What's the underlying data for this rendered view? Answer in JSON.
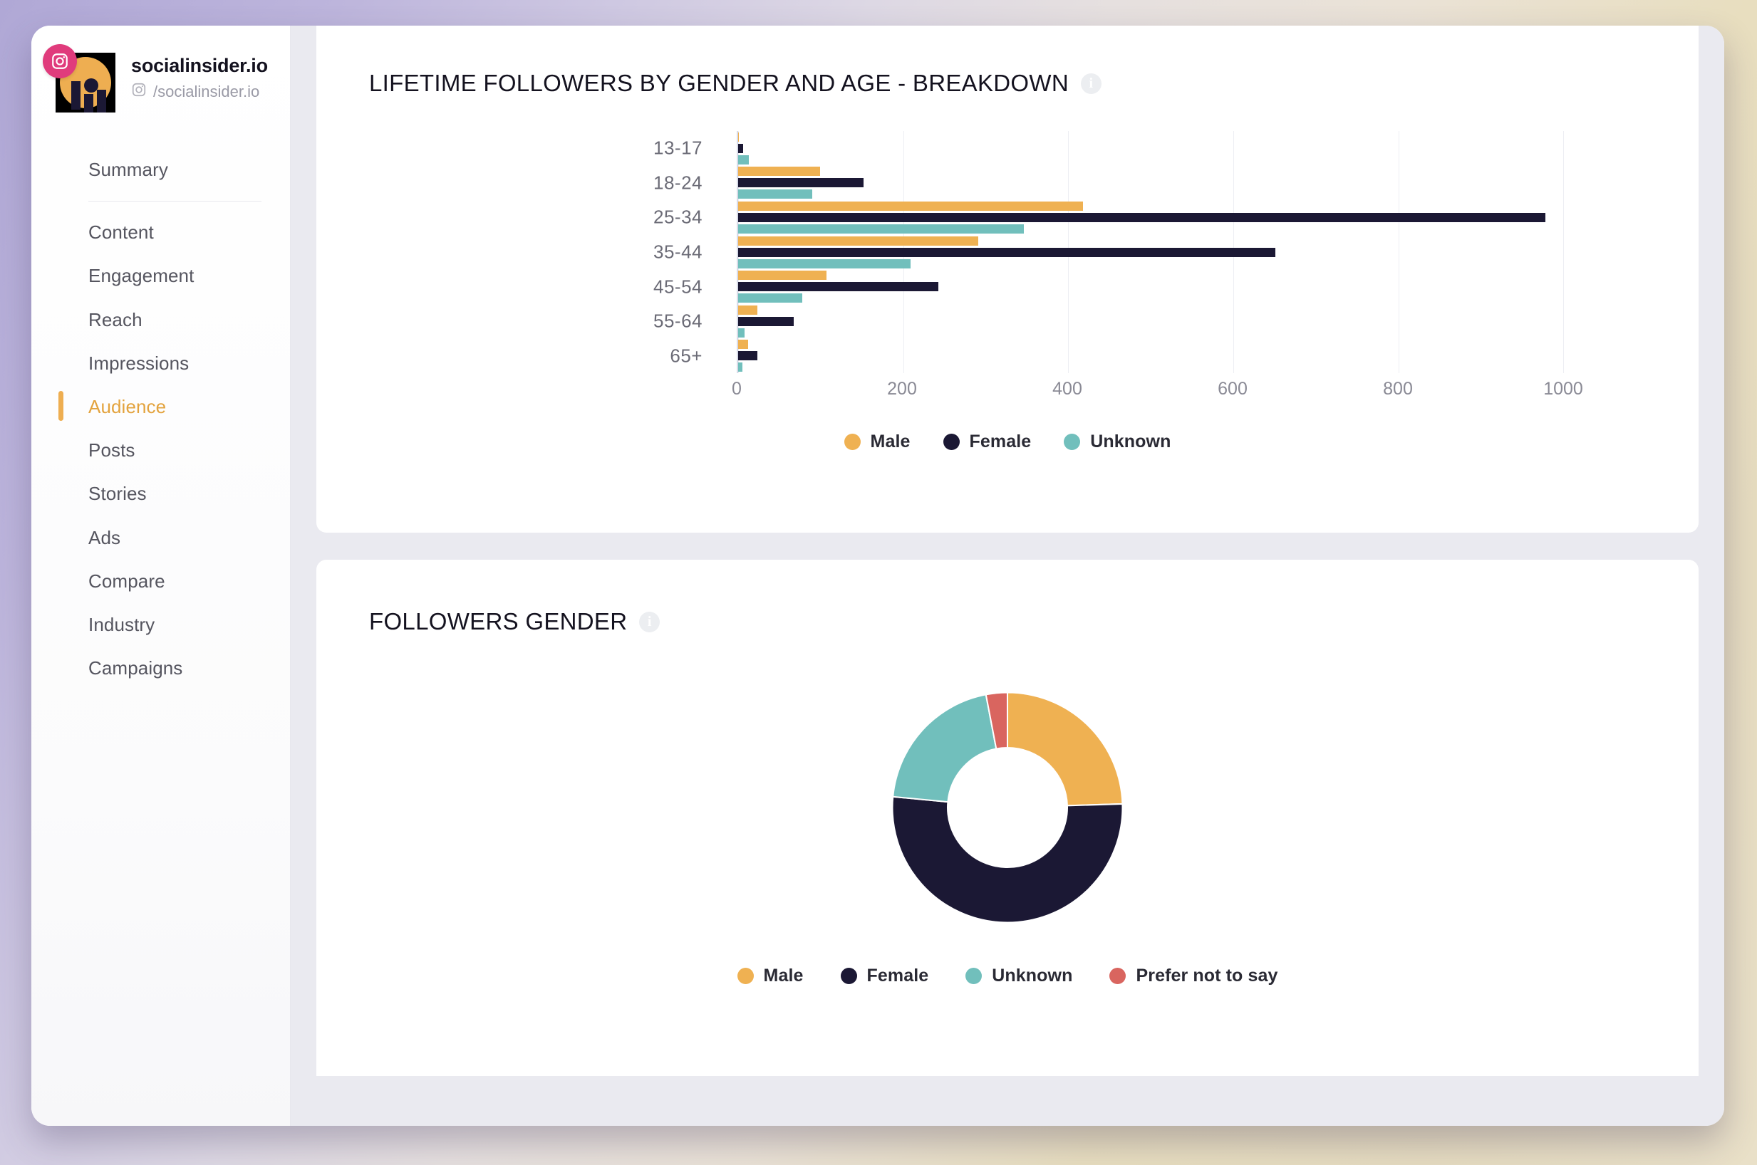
{
  "profile": {
    "name": "socialinsider.io",
    "handle": "/socialinsider.io",
    "network_icon": "instagram-icon",
    "badge_icon": "instagram-badge-icon",
    "badge_color": "#e03b7c"
  },
  "sidebar": {
    "items": [
      {
        "label": "Summary",
        "active": false,
        "separator_after": true
      },
      {
        "label": "Content",
        "active": false,
        "separator_after": false
      },
      {
        "label": "Engagement",
        "active": false,
        "separator_after": false
      },
      {
        "label": "Reach",
        "active": false,
        "separator_after": false
      },
      {
        "label": "Impressions",
        "active": false,
        "separator_after": false
      },
      {
        "label": "Audience",
        "active": true,
        "separator_after": false
      },
      {
        "label": "Posts",
        "active": false,
        "separator_after": false
      },
      {
        "label": "Stories",
        "active": false,
        "separator_after": false
      },
      {
        "label": "Ads",
        "active": false,
        "separator_after": false
      },
      {
        "label": "Compare",
        "active": false,
        "separator_after": false
      },
      {
        "label": "Industry",
        "active": false,
        "separator_after": false
      },
      {
        "label": "Campaigns",
        "active": false,
        "separator_after": false
      }
    ],
    "active_color": "#e3a33e"
  },
  "cards": {
    "breakdown": {
      "title": "LIFETIME FOLLOWERS BY GENDER AND AGE - BREAKDOWN",
      "info_icon": "info-icon"
    },
    "gender": {
      "title": "FOLLOWERS GENDER",
      "info_icon": "info-icon"
    }
  },
  "colors": {
    "male": "#efb152",
    "female": "#1b1834",
    "unknown": "#71bfbc",
    "prefer_not_to_say": "#d9655f",
    "grid": "#edeef3",
    "axis": "#d7dae8"
  },
  "chart_data": [
    {
      "type": "bar",
      "orientation": "horizontal",
      "title": "LIFETIME FOLLOWERS BY GENDER AND AGE - BREAKDOWN",
      "xlabel": "",
      "ylabel": "",
      "categories": [
        "13-17",
        "18-24",
        "25-34",
        "35-44",
        "45-54",
        "55-64",
        "65+"
      ],
      "series": [
        {
          "name": "Male",
          "color": "#efb152",
          "values": [
            1,
            99,
            418,
            291,
            107,
            23,
            12
          ]
        },
        {
          "name": "Female",
          "color": "#1b1834",
          "values": [
            6,
            152,
            978,
            651,
            243,
            67,
            23
          ]
        },
        {
          "name": "Unknown",
          "color": "#71bfbc",
          "values": [
            13,
            90,
            346,
            209,
            78,
            8,
            5
          ]
        }
      ],
      "xticks": [
        0,
        200,
        400,
        600,
        800,
        1000
      ],
      "xlim": [
        0,
        1100
      ],
      "grid": true,
      "legend": [
        "Male",
        "Female",
        "Unknown"
      ],
      "legend_position": "bottom"
    },
    {
      "type": "pie",
      "variant": "donut",
      "title": "FOLLOWERS GENDER",
      "labels": [
        "Male",
        "Female",
        "Unknown",
        "Prefer not to say"
      ],
      "values": [
        24.5,
        52.0,
        20.5,
        3.0
      ],
      "colors": [
        "#efb152",
        "#1b1834",
        "#71bfbc",
        "#d9655f"
      ],
      "legend": [
        "Male",
        "Female",
        "Unknown",
        "Prefer not to say"
      ],
      "legend_position": "bottom",
      "hole": 0.52,
      "start_angle": 0
    }
  ]
}
